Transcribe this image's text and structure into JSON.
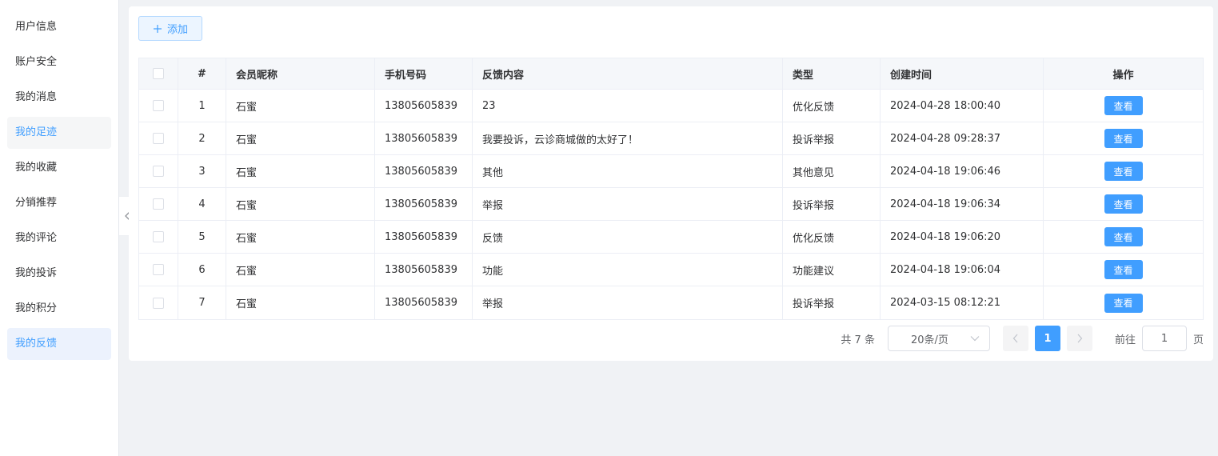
{
  "sidebar": {
    "items": [
      {
        "label": "用户信息"
      },
      {
        "label": "账户安全"
      },
      {
        "label": "我的消息"
      },
      {
        "label": "我的足迹"
      },
      {
        "label": "我的收藏"
      },
      {
        "label": "分销推荐"
      },
      {
        "label": "我的评论"
      },
      {
        "label": "我的投诉"
      },
      {
        "label": "我的积分"
      },
      {
        "label": "我的反馈"
      }
    ],
    "active": "我的反馈"
  },
  "toolbar": {
    "add_label": "添加",
    "add_icon": "plus-icon"
  },
  "table": {
    "headers": {
      "index": "#",
      "nickname": "会员昵称",
      "phone": "手机号码",
      "content": "反馈内容",
      "type": "类型",
      "created": "创建时间",
      "action": "操作"
    },
    "rows": [
      {
        "index": "1",
        "nickname": "石蜜",
        "phone": "13805605839",
        "content": "23",
        "type": "优化反馈",
        "created": "2024-04-28 18:00:40",
        "action": "查看"
      },
      {
        "index": "2",
        "nickname": "石蜜",
        "phone": "13805605839",
        "content": "我要投诉，云诊商城做的太好了！",
        "type": "投诉举报",
        "created": "2024-04-28 09:28:37",
        "action": "查看"
      },
      {
        "index": "3",
        "nickname": "石蜜",
        "phone": "13805605839",
        "content": "其他",
        "type": "其他意见",
        "created": "2024-04-18 19:06:46",
        "action": "查看"
      },
      {
        "index": "4",
        "nickname": "石蜜",
        "phone": "13805605839",
        "content": "举报",
        "type": "投诉举报",
        "created": "2024-04-18 19:06:34",
        "action": "查看"
      },
      {
        "index": "5",
        "nickname": "石蜜",
        "phone": "13805605839",
        "content": "反馈",
        "type": "优化反馈",
        "created": "2024-04-18 19:06:20",
        "action": "查看"
      },
      {
        "index": "6",
        "nickname": "石蜜",
        "phone": "13805605839",
        "content": "功能",
        "type": "功能建议",
        "created": "2024-04-18 19:06:04",
        "action": "查看"
      },
      {
        "index": "7",
        "nickname": "石蜜",
        "phone": "13805605839",
        "content": "举报",
        "type": "投诉举报",
        "created": "2024-03-15 08:12:21",
        "action": "查看"
      }
    ]
  },
  "pagination": {
    "total": "共 7 条",
    "page_size": "20条/页",
    "current_page": "1",
    "goto_label": "前往",
    "goto_value": "1",
    "page_suffix": "页"
  },
  "colors": {
    "primary": "#409eff",
    "active_bg": "#ecf2fd",
    "page_bg": "#f0f2f5"
  }
}
